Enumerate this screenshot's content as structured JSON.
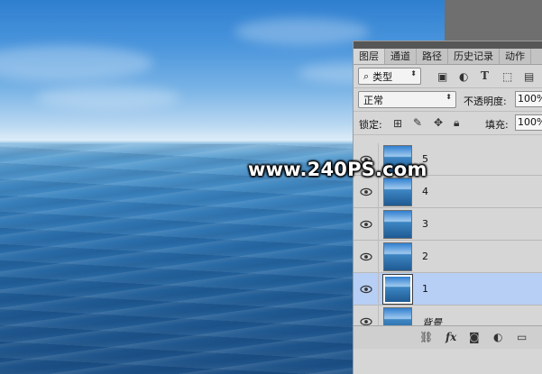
{
  "watermark": "www.240PS.com",
  "panel": {
    "tabs": [
      "图层",
      "通道",
      "路径",
      "历史记录",
      "动作"
    ],
    "filter_type": "类型",
    "blend_mode": "正常",
    "opacity_label": "不透明度:",
    "opacity_value": "100%",
    "lock_label": "锁定:",
    "fill_label": "填充:",
    "fill_value": "100%",
    "layers": [
      "5",
      "4",
      "3",
      "2",
      "1",
      "背景"
    ]
  },
  "colors": {
    "selected_layer": "#b7cff5",
    "panel_bg": "#d6d6d6"
  }
}
